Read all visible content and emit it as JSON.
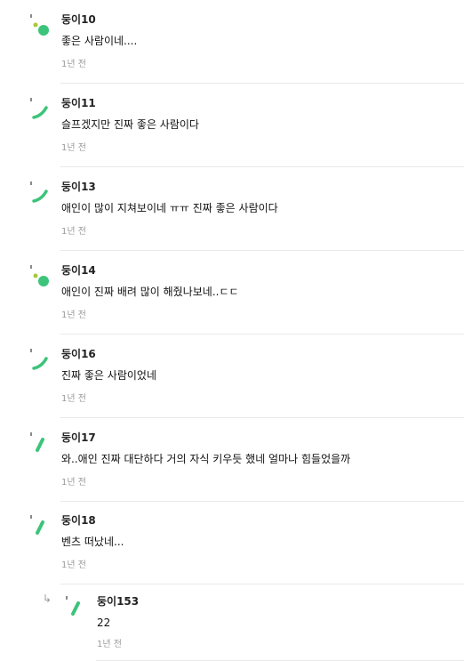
{
  "comments": [
    {
      "nickname": "둥이10",
      "text": "좋은 사람이네....",
      "time": "1년 전",
      "avatar": "dot-avatar-icon"
    },
    {
      "nickname": "둥이11",
      "text": "슬프겠지만 진짜 좋은 사람이다",
      "time": "1년 전",
      "avatar": "smile-avatar-icon"
    },
    {
      "nickname": "둥이13",
      "text": "애인이 많이 지쳐보이네 ㅠㅠ 진짜 좋은 사람이다",
      "time": "1년 전",
      "avatar": "smile-avatar-icon"
    },
    {
      "nickname": "둥이14",
      "text": "애인이 진짜 배려 많이 해줬나보네..ㄷㄷ",
      "time": "1년 전",
      "avatar": "dot-avatar-icon"
    },
    {
      "nickname": "둥이16",
      "text": "진짜 좋은 사람이었네",
      "time": "1년 전",
      "avatar": "smile-avatar-icon"
    },
    {
      "nickname": "둥이17",
      "text": "와..애인 진짜 대단하다 거의 자식 키우듯 했네 얼마나 힘들었을까",
      "time": "1년 전",
      "avatar": "slash-avatar-icon"
    },
    {
      "nickname": "둥이18",
      "text": "벤츠 떠났네...",
      "time": "1년 전",
      "avatar": "slash-avatar-icon"
    }
  ],
  "reply": {
    "arrow": "↳",
    "nickname": "둥이153",
    "text": "22",
    "time": "1년 전",
    "avatar": "slash-avatar-icon"
  },
  "colors": {
    "avatar_green": "#3cc47a",
    "avatar_lime": "#a6c93a",
    "avatar_gray": "#8a8a8a",
    "timestamp": "#9a9a9a",
    "divider": "#e9e9e9"
  }
}
